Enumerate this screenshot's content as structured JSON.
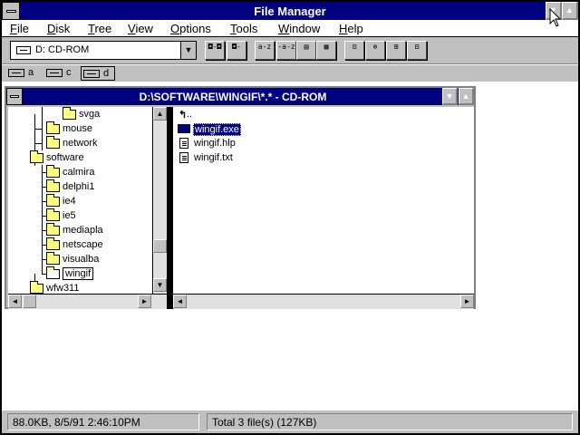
{
  "app": {
    "title": "File Manager"
  },
  "menu": [
    "File",
    "Disk",
    "Tree",
    "View",
    "Options",
    "Tools",
    "Window",
    "Help"
  ],
  "menu_accel": [
    "F",
    "D",
    "T",
    "V",
    "O",
    "T",
    "W",
    "H"
  ],
  "toolbar": {
    "drive_combo_value": "D: CD-ROM",
    "buttons": [
      {
        "name": "connect-drive",
        "glyph": "◘-◘"
      },
      {
        "name": "disconnect-drive",
        "glyph": "◘-"
      },
      {
        "name": "sort-by-name",
        "glyph": "a-z"
      },
      {
        "name": "sort-by-type",
        "glyph": "-a-z"
      },
      {
        "name": "view-name",
        "glyph": "▤"
      },
      {
        "name": "view-details",
        "glyph": "▦"
      },
      {
        "name": "connect-network",
        "glyph": "⊡"
      },
      {
        "name": "share-as",
        "glyph": "⊕"
      },
      {
        "name": "print",
        "glyph": "⊞"
      },
      {
        "name": "stop-sharing",
        "glyph": "⊟"
      }
    ]
  },
  "drives": [
    {
      "letter": "a",
      "selected": false
    },
    {
      "letter": "c",
      "selected": false
    },
    {
      "letter": "d",
      "selected": true
    }
  ],
  "child_window": {
    "title": "D:\\SOFTWARE\\WINGIF\\*.* - CD-ROM"
  },
  "tree": [
    {
      "label": "svga",
      "selected": false,
      "open": false
    },
    {
      "label": "mouse",
      "selected": false,
      "open": false
    },
    {
      "label": "network",
      "selected": false,
      "open": false
    },
    {
      "label": "software",
      "selected": false,
      "open": false
    },
    {
      "label": "calmira",
      "selected": false,
      "open": false
    },
    {
      "label": "delphi1",
      "selected": false,
      "open": false
    },
    {
      "label": "ie4",
      "selected": false,
      "open": false
    },
    {
      "label": "ie5",
      "selected": false,
      "open": false
    },
    {
      "label": "mediapla",
      "selected": false,
      "open": false
    },
    {
      "label": "netscape",
      "selected": false,
      "open": false
    },
    {
      "label": "visualba",
      "selected": false,
      "open": false
    },
    {
      "label": "wingif",
      "selected": true,
      "open": true
    },
    {
      "label": "wfw311",
      "selected": false,
      "open": false
    }
  ],
  "files": {
    "up_label": "..",
    "items": [
      {
        "label": "wingif.exe",
        "type": "exe",
        "selected": true
      },
      {
        "label": "wingif.hlp",
        "type": "doc",
        "selected": false
      },
      {
        "label": "wingif.txt",
        "type": "doc",
        "selected": false
      }
    ]
  },
  "status": {
    "left": "88.0KB, 8/5/91 2:46:10PM",
    "right": "Total 3 file(s) (127KB)"
  },
  "colors": {
    "titlebar": "#000080",
    "face": "#c0c0c0",
    "folder": "#ffff80"
  }
}
